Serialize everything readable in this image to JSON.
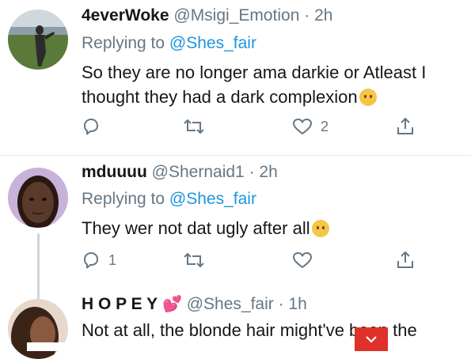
{
  "tweets": [
    {
      "name": "4everWoke",
      "handle": "@Msigi_Emotion",
      "time": "· 2h",
      "reply_prefix": "Replying to ",
      "reply_to": "@Shes_fair",
      "text": "So they are no longer ama darkie or Atleast I thought they had a dark complexion",
      "reply_count": "",
      "retweet_count": "",
      "like_count": "2",
      "avatar_colors": {
        "sky": "#cfd8dc",
        "grass": "#5b7a3a",
        "person": "#2b2b2b"
      }
    },
    {
      "name": "mduuuu",
      "handle": "@Shernaid1",
      "time": "· 2h",
      "reply_prefix": "Replying to ",
      "reply_to": "@Shes_fair",
      "text": "They wer not dat ugly after all",
      "reply_count": "1",
      "retweet_count": "",
      "like_count": "",
      "avatar_colors": {
        "bg": "#c9b2d9",
        "skin": "#5a3a2a"
      }
    },
    {
      "name": "H O P E Y",
      "name_emoji": "💕",
      "handle": "@Shes_fair",
      "time": "· 1h",
      "text": "Not at all, the blonde hair might've been the",
      "avatar_colors": {
        "bg": "#e8d8cc",
        "hair": "#3a2418"
      }
    }
  ],
  "icons": {
    "reply": "reply-icon",
    "retweet": "retweet-icon",
    "like": "heart-icon",
    "share": "share-icon",
    "scroll": "chevron-down-icon"
  },
  "colors": {
    "link": "#1b95e0",
    "muted": "#657786",
    "text": "#14171a",
    "scroll_button": "#e0302a"
  }
}
